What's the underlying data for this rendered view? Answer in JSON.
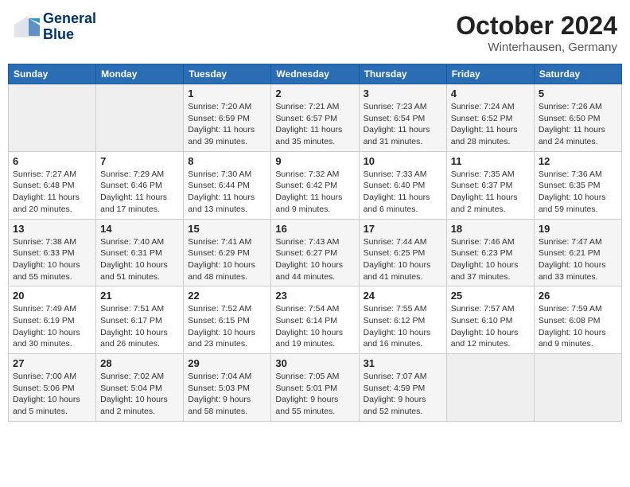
{
  "header": {
    "logo_line1": "General",
    "logo_line2": "Blue",
    "month": "October 2024",
    "location": "Winterhausen, Germany"
  },
  "weekdays": [
    "Sunday",
    "Monday",
    "Tuesday",
    "Wednesday",
    "Thursday",
    "Friday",
    "Saturday"
  ],
  "weeks": [
    [
      {
        "day": "",
        "info": ""
      },
      {
        "day": "",
        "info": ""
      },
      {
        "day": "1",
        "info": "Sunrise: 7:20 AM\nSunset: 6:59 PM\nDaylight: 11 hours and 39 minutes."
      },
      {
        "day": "2",
        "info": "Sunrise: 7:21 AM\nSunset: 6:57 PM\nDaylight: 11 hours and 35 minutes."
      },
      {
        "day": "3",
        "info": "Sunrise: 7:23 AM\nSunset: 6:54 PM\nDaylight: 11 hours and 31 minutes."
      },
      {
        "day": "4",
        "info": "Sunrise: 7:24 AM\nSunset: 6:52 PM\nDaylight: 11 hours and 28 minutes."
      },
      {
        "day": "5",
        "info": "Sunrise: 7:26 AM\nSunset: 6:50 PM\nDaylight: 11 hours and 24 minutes."
      }
    ],
    [
      {
        "day": "6",
        "info": "Sunrise: 7:27 AM\nSunset: 6:48 PM\nDaylight: 11 hours and 20 minutes."
      },
      {
        "day": "7",
        "info": "Sunrise: 7:29 AM\nSunset: 6:46 PM\nDaylight: 11 hours and 17 minutes."
      },
      {
        "day": "8",
        "info": "Sunrise: 7:30 AM\nSunset: 6:44 PM\nDaylight: 11 hours and 13 minutes."
      },
      {
        "day": "9",
        "info": "Sunrise: 7:32 AM\nSunset: 6:42 PM\nDaylight: 11 hours and 9 minutes."
      },
      {
        "day": "10",
        "info": "Sunrise: 7:33 AM\nSunset: 6:40 PM\nDaylight: 11 hours and 6 minutes."
      },
      {
        "day": "11",
        "info": "Sunrise: 7:35 AM\nSunset: 6:37 PM\nDaylight: 11 hours and 2 minutes."
      },
      {
        "day": "12",
        "info": "Sunrise: 7:36 AM\nSunset: 6:35 PM\nDaylight: 10 hours and 59 minutes."
      }
    ],
    [
      {
        "day": "13",
        "info": "Sunrise: 7:38 AM\nSunset: 6:33 PM\nDaylight: 10 hours and 55 minutes."
      },
      {
        "day": "14",
        "info": "Sunrise: 7:40 AM\nSunset: 6:31 PM\nDaylight: 10 hours and 51 minutes."
      },
      {
        "day": "15",
        "info": "Sunrise: 7:41 AM\nSunset: 6:29 PM\nDaylight: 10 hours and 48 minutes."
      },
      {
        "day": "16",
        "info": "Sunrise: 7:43 AM\nSunset: 6:27 PM\nDaylight: 10 hours and 44 minutes."
      },
      {
        "day": "17",
        "info": "Sunrise: 7:44 AM\nSunset: 6:25 PM\nDaylight: 10 hours and 41 minutes."
      },
      {
        "day": "18",
        "info": "Sunrise: 7:46 AM\nSunset: 6:23 PM\nDaylight: 10 hours and 37 minutes."
      },
      {
        "day": "19",
        "info": "Sunrise: 7:47 AM\nSunset: 6:21 PM\nDaylight: 10 hours and 33 minutes."
      }
    ],
    [
      {
        "day": "20",
        "info": "Sunrise: 7:49 AM\nSunset: 6:19 PM\nDaylight: 10 hours and 30 minutes."
      },
      {
        "day": "21",
        "info": "Sunrise: 7:51 AM\nSunset: 6:17 PM\nDaylight: 10 hours and 26 minutes."
      },
      {
        "day": "22",
        "info": "Sunrise: 7:52 AM\nSunset: 6:15 PM\nDaylight: 10 hours and 23 minutes."
      },
      {
        "day": "23",
        "info": "Sunrise: 7:54 AM\nSunset: 6:14 PM\nDaylight: 10 hours and 19 minutes."
      },
      {
        "day": "24",
        "info": "Sunrise: 7:55 AM\nSunset: 6:12 PM\nDaylight: 10 hours and 16 minutes."
      },
      {
        "day": "25",
        "info": "Sunrise: 7:57 AM\nSunset: 6:10 PM\nDaylight: 10 hours and 12 minutes."
      },
      {
        "day": "26",
        "info": "Sunrise: 7:59 AM\nSunset: 6:08 PM\nDaylight: 10 hours and 9 minutes."
      }
    ],
    [
      {
        "day": "27",
        "info": "Sunrise: 7:00 AM\nSunset: 5:06 PM\nDaylight: 10 hours and 5 minutes."
      },
      {
        "day": "28",
        "info": "Sunrise: 7:02 AM\nSunset: 5:04 PM\nDaylight: 10 hours and 2 minutes."
      },
      {
        "day": "29",
        "info": "Sunrise: 7:04 AM\nSunset: 5:03 PM\nDaylight: 9 hours and 58 minutes."
      },
      {
        "day": "30",
        "info": "Sunrise: 7:05 AM\nSunset: 5:01 PM\nDaylight: 9 hours and 55 minutes."
      },
      {
        "day": "31",
        "info": "Sunrise: 7:07 AM\nSunset: 4:59 PM\nDaylight: 9 hours and 52 minutes."
      },
      {
        "day": "",
        "info": ""
      },
      {
        "day": "",
        "info": ""
      }
    ]
  ]
}
